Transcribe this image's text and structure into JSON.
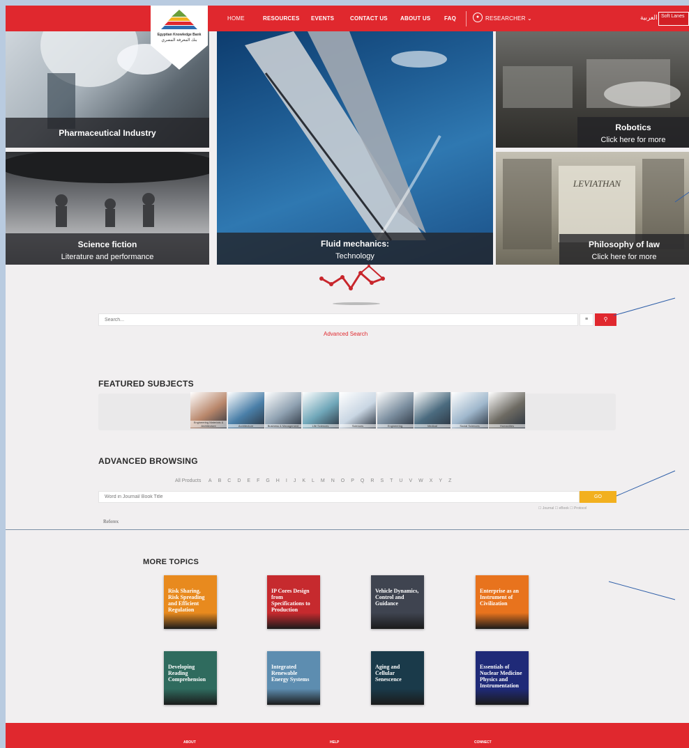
{
  "logo": {
    "name_en": "Egyptian Knowledge Bank",
    "name_ar": "بنك المعرفة المصري"
  },
  "nav": {
    "items": [
      "HOME",
      "RESOURCES",
      "EVENTS",
      "CONTACT US",
      "ABOUT US",
      "FAQ"
    ],
    "researcher": "RESEARCHER ⌄",
    "language": "العربية",
    "partner_badge": "Soft Lanes"
  },
  "hero": {
    "pharma": {
      "title": "Pharmaceutical Industry"
    },
    "scifi": {
      "title": "Science fiction",
      "subtitle": "Literature and performance"
    },
    "fluid": {
      "title": "Fluid mechanics:",
      "subtitle": "Technology"
    },
    "robotics": {
      "title": "Robotics",
      "subtitle": "Click here for more"
    },
    "law": {
      "title": "Philosophy of law",
      "subtitle": "Click here for more"
    }
  },
  "search": {
    "placeholder": "Search...",
    "menu_glyph": "≡",
    "button_glyph": "⚲",
    "advanced_link": "Advanced Search"
  },
  "featured": {
    "heading": "FEATURED SUBJECTS",
    "subjects": [
      {
        "label": "Engineering Materials & Architecture",
        "color": "#b8866a"
      },
      {
        "label": "Architecture",
        "color": "#4a7fa8"
      },
      {
        "label": "Business & Management",
        "color": "#8fa1b1"
      },
      {
        "label": "Life Sciences",
        "color": "#6fa6b8"
      },
      {
        "label": "Sciences",
        "color": "#c9d6e3"
      },
      {
        "label": "Engineering",
        "color": "#7b8e9f"
      },
      {
        "label": "Medical",
        "color": "#4b6b7f"
      },
      {
        "label": "Social Sciences",
        "color": "#9fb7cc"
      },
      {
        "label": "Humanities",
        "color": "#6d6a62"
      }
    ]
  },
  "browsing": {
    "heading": "ADVANCED BROWSING",
    "all_products": "All Products",
    "letters": [
      "A",
      "B",
      "C",
      "D",
      "E",
      "F",
      "G",
      "H",
      "I",
      "J",
      "K",
      "L",
      "M",
      "N",
      "O",
      "P",
      "Q",
      "R",
      "S",
      "T",
      "U",
      "V",
      "W",
      "X",
      "Y",
      "Z"
    ],
    "placeholder": "Word in Journal/ Book Title",
    "go": "GO",
    "filters": "☐ Journal ☐ eBook ☐ Protocol",
    "logo_text": "Referex"
  },
  "more_topics": {
    "heading": "MORE TOPICS",
    "books": [
      {
        "title": "Risk Sharing, Risk Spreading and Efficient Regulation",
        "color": "#e88a1e"
      },
      {
        "title": "IP Cores Design from Specifications to Production",
        "color": "#c62a2e"
      },
      {
        "title": "Vehicle Dynamics, Control and Guidance",
        "color": "#3f4450"
      },
      {
        "title": "Enterprise as an Instrument of Civilization",
        "color": "#e8731d"
      },
      {
        "title": "Developing Reading Comprehension",
        "color": "#2f6b5e"
      },
      {
        "title": "Integrated Renewable Energy Systems",
        "color": "#5d8db0"
      },
      {
        "title": "Aging and Cellular Senescence",
        "color": "#1a3a4a"
      },
      {
        "title": "Essentials of Nuclear Medicine Physics and Instrumentation",
        "color": "#1f2a78"
      }
    ]
  },
  "footer": {
    "items": [
      "ABOUT",
      "HELP",
      "CONNECT"
    ]
  }
}
